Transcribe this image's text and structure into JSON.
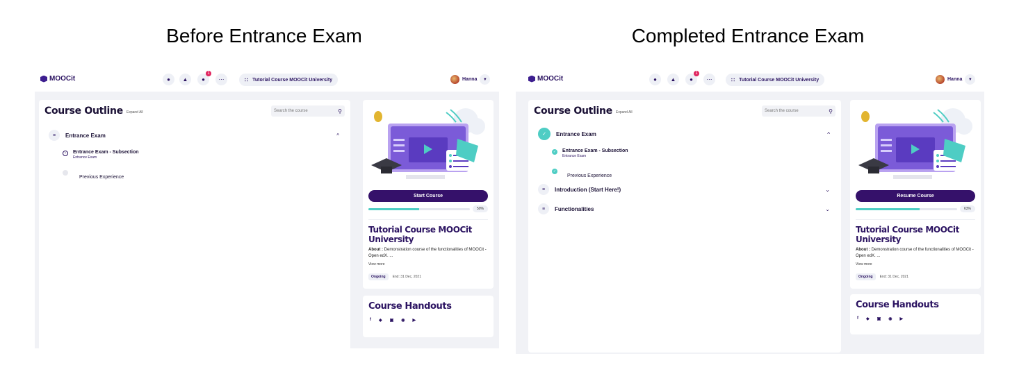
{
  "captions": {
    "left": "Before Entrance Exam",
    "right": "Completed Entrance Exam"
  },
  "colors": {
    "brand": "#35116a",
    "accent": "#4ecdc4",
    "badge": "#e0245e"
  },
  "before": {
    "header": {
      "logo": "MOOCit",
      "icons": [
        "chat-icon",
        "trophy-icon",
        "bell-icon",
        "more-icon"
      ],
      "notification_count": "1",
      "course_switch": "Tutorial Course MOOCit University",
      "user_name": "Hanna"
    },
    "outline": {
      "title": "Course Outline",
      "expand_all": "Expand All",
      "search_placeholder": "Search the course",
      "sections": [
        {
          "title": "Entrance Exam",
          "icon": "list-icon",
          "expanded": true,
          "subsections": [
            {
              "title": "Entrance Exam - Subsection",
              "caption": "Entrance Exam",
              "icon": "target-icon"
            },
            {
              "title": "Previous Experience",
              "caption": "",
              "icon": "empty-circle-icon"
            }
          ]
        }
      ]
    },
    "course_card": {
      "cta": "Start Course",
      "progress_percent": 50,
      "progress_label": "50%",
      "name": "Tutorial Course MOOCit University",
      "about_label": "About :",
      "about_text": "Demonstration course of the functionalities of MOOCit - Open edX. ...",
      "view_more": "View more",
      "status": "Ongoing",
      "end_date": "End: 31 Dec, 2021"
    },
    "handouts": {
      "title": "Course Handouts",
      "socials": [
        "f",
        "t",
        "ig",
        "p",
        "yt"
      ]
    }
  },
  "after": {
    "header": {
      "logo": "MOOCit",
      "icons": [
        "chat-icon",
        "trophy-icon",
        "bell-icon",
        "more-icon"
      ],
      "notification_count": "1",
      "course_switch": "Tutorial Course MOOCit University",
      "user_name": "Hanna"
    },
    "outline": {
      "title": "Course Outline",
      "expand_all": "Expand All",
      "search_placeholder": "Search the course",
      "sections": [
        {
          "title": "Entrance Exam",
          "icon": "check-icon",
          "expanded": true,
          "subsections": [
            {
              "title": "Entrance Exam - Subsection",
              "caption": "Entrance Exam",
              "icon": "check-icon"
            },
            {
              "title": "Previous Experience",
              "caption": "",
              "icon": "check-icon"
            }
          ]
        },
        {
          "title": "Introduction (Start Here!)",
          "icon": "list-icon",
          "expanded": false
        },
        {
          "title": "Functionalities",
          "icon": "list-icon",
          "expanded": false
        }
      ]
    },
    "course_card": {
      "cta": "Resume Course",
      "progress_percent": 63,
      "progress_label": "63%",
      "name": "Tutorial Course MOOCit University",
      "about_label": "About :",
      "about_text": "Demonstration course of the functionalities of MOOCit - Open edX. ...",
      "view_more": "View more",
      "status": "Ongoing",
      "end_date": "End: 31 Dec, 2021"
    },
    "handouts": {
      "title": "Course Handouts",
      "socials": [
        "f",
        "t",
        "ig",
        "p",
        "yt"
      ]
    }
  }
}
